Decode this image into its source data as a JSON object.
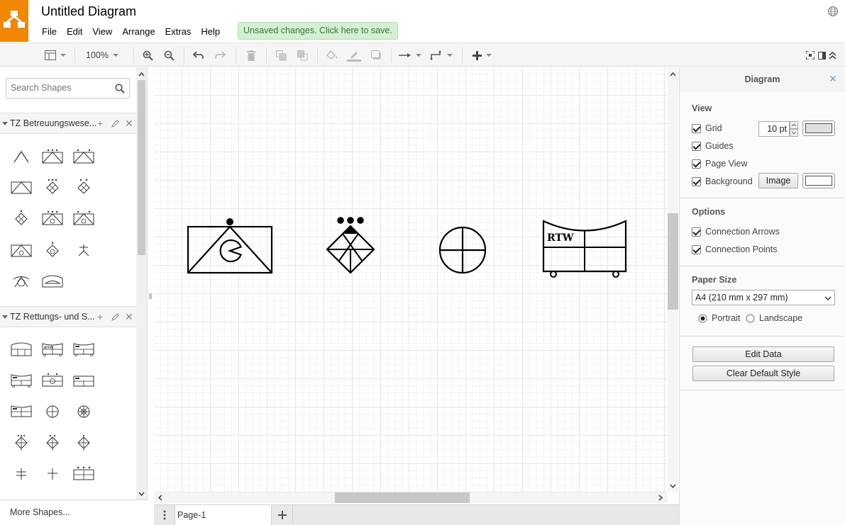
{
  "app": {
    "title": "Untitled Diagram",
    "save_status": "Unsaved changes. Click here to save.",
    "menu": [
      "File",
      "Edit",
      "View",
      "Arrange",
      "Extras",
      "Help"
    ],
    "accent_color": "#f08705"
  },
  "toolbar": {
    "zoom": "100%",
    "icons": [
      "format-panel-icon",
      "zoom-in-icon",
      "zoom-out-icon",
      "undo-icon",
      "redo-icon",
      "delete-icon",
      "to-front-icon",
      "to-back-icon",
      "fill-color-icon",
      "line-color-icon",
      "shadow-icon",
      "connection-icon",
      "waypoints-icon",
      "insert-icon",
      "fullscreen-icon",
      "format-toggle-icon",
      "collapse-icon"
    ]
  },
  "sidebar": {
    "search_placeholder": "Search Shapes",
    "libraries": [
      {
        "title": "TZ Betreuungswese...",
        "shape_count": 14
      },
      {
        "title": "TZ Rettungs- und S...",
        "shape_count": 15
      }
    ],
    "more_shapes": "More Shapes..."
  },
  "canvas": {
    "shapes": [
      {
        "name": "betreuung-symbol"
      },
      {
        "name": "trupp-diamond-symbol"
      },
      {
        "name": "circle-cross-symbol"
      },
      {
        "name": "rtw-vehicle-symbol",
        "label": "RTW"
      }
    ]
  },
  "pages": {
    "tabs": [
      "Page-1"
    ]
  },
  "panel": {
    "title": "Diagram",
    "view_heading": "View",
    "grid_label": "Grid",
    "grid_size": "10 pt",
    "guides_label": "Guides",
    "page_view_label": "Page View",
    "background_label": "Background",
    "image_button": "Image",
    "options_heading": "Options",
    "connection_arrows_label": "Connection Arrows",
    "connection_points_label": "Connection Points",
    "paper_size_heading": "Paper Size",
    "paper_size_value": "A4 (210 mm x 297 mm)",
    "portrait_label": "Portrait",
    "landscape_label": "Landscape",
    "edit_data_button": "Edit Data",
    "clear_style_button": "Clear Default Style",
    "checks": {
      "grid": true,
      "guides": true,
      "page_view": true,
      "background": true,
      "connection_arrows": true,
      "connection_points": true
    },
    "orientation": "portrait"
  }
}
